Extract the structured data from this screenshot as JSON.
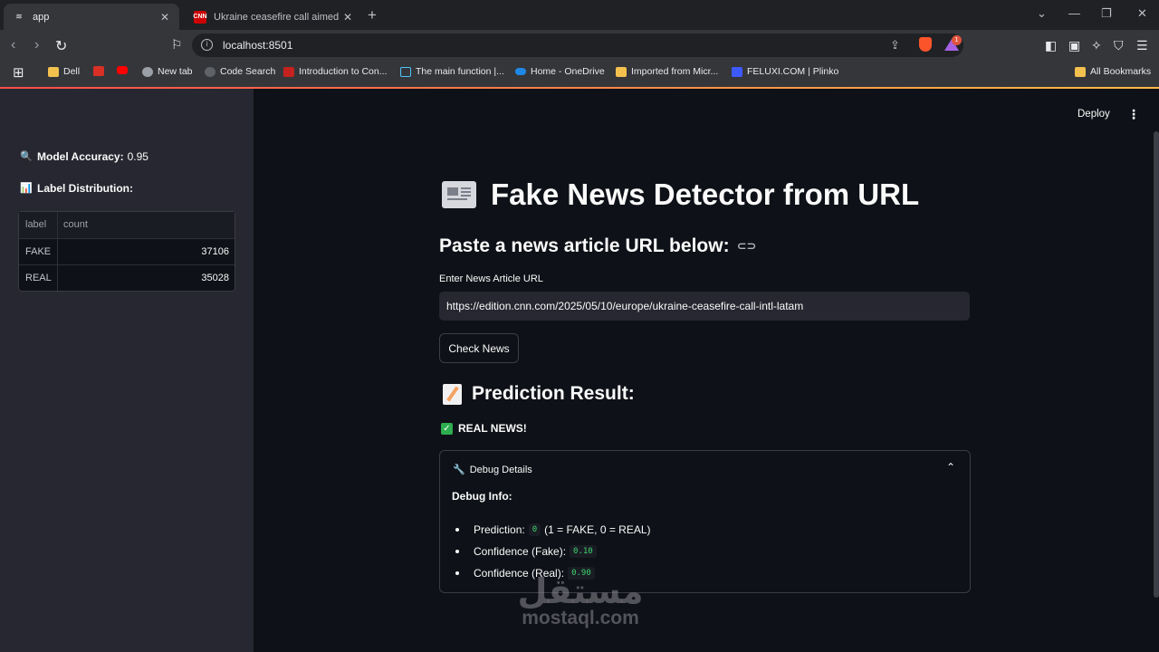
{
  "browser": {
    "tabs": [
      {
        "title": "app",
        "active": true
      },
      {
        "title": "Ukraine ceasefire call aimed at forci",
        "active": false,
        "favicon_text": "CNN"
      }
    ],
    "address": "localhost:8501",
    "extension_badge": "1",
    "bookmarks": [
      {
        "label": "Dell",
        "icon": "folder-icon"
      },
      {
        "label": "",
        "icon": "app-icon"
      },
      {
        "label": "",
        "icon": "youtube-icon"
      },
      {
        "label": "New tab",
        "icon": "globe-icon"
      },
      {
        "label": "Code Search",
        "icon": "code-search-icon"
      },
      {
        "label": "Introduction to Con...",
        "icon": "course-icon"
      },
      {
        "label": "The main function |...",
        "icon": "docs-icon"
      },
      {
        "label": "Home - OneDrive",
        "icon": "onedrive-icon"
      },
      {
        "label": "Imported from Micr...",
        "icon": "folder-icon"
      },
      {
        "label": "FELUXI.COM | Plinko",
        "icon": "site-icon"
      }
    ],
    "all_bookmarks_label": "All Bookmarks"
  },
  "sidebar": {
    "accuracy_label": "Model Accuracy:",
    "accuracy_value": "0.95",
    "distribution_title": "Label Distribution:",
    "table": {
      "columns": [
        "label",
        "count"
      ],
      "rows": [
        [
          "FAKE",
          "37106"
        ],
        [
          "REAL",
          "35028"
        ]
      ]
    }
  },
  "header": {
    "deploy_label": "Deploy"
  },
  "main": {
    "title": "Fake News Detector from URL",
    "subtitle": "Paste a news article URL below:",
    "input_label": "Enter News Article URL",
    "input_value": "https://edition.cnn.com/2025/05/10/europe/ukraine-ceasefire-call-intl-latam",
    "button_label": "Check News",
    "result_heading": "Prediction Result:",
    "result_text": "REAL NEWS!",
    "expander_title": "Debug Details",
    "debug_title": "Debug Info:",
    "debug": {
      "prediction_label": "Prediction:",
      "prediction_value": "0",
      "prediction_note": "(1 = FAKE, 0 = REAL)",
      "conf_fake_label": "Confidence (Fake):",
      "conf_fake_value": "0.10",
      "conf_real_label": "Confidence (Real):",
      "conf_real_value": "0.90"
    }
  },
  "watermark": {
    "arabic": "مستقل",
    "latin": "mostaql.com"
  },
  "colors": {
    "accent": "#ff4b4b",
    "success": "#2eae4f",
    "code": "#3dd56d",
    "sidebar": "#262730",
    "background": "#0e1117"
  }
}
